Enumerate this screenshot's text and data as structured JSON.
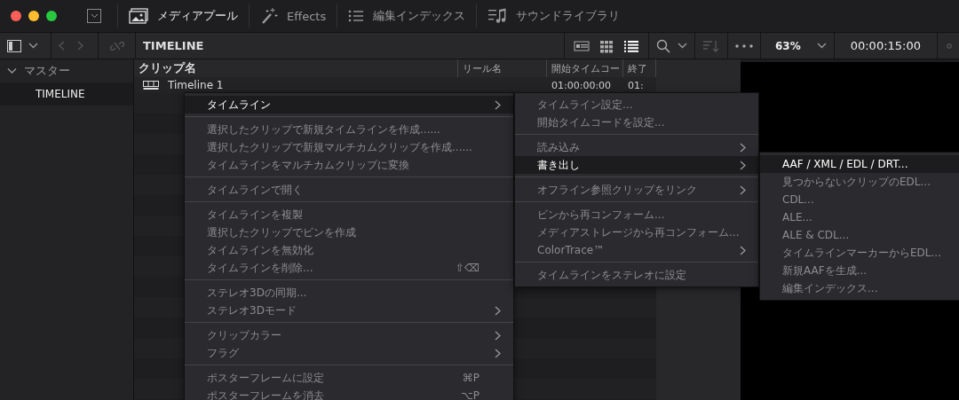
{
  "toolbar": {
    "tabs": [
      {
        "label": "メディアプール",
        "selected": true
      },
      {
        "label": "Effects",
        "selected": false
      },
      {
        "label": "編集インデックス",
        "selected": false
      },
      {
        "label": "サウンドライブラリ",
        "selected": false
      }
    ]
  },
  "bin_bar": {
    "title": "TIMELINE",
    "views": [
      {
        "selected": false
      },
      {
        "selected": false
      },
      {
        "selected": true
      }
    ],
    "zoom": "63%",
    "timecode": "00:00:15:00"
  },
  "sidebar": {
    "items": [
      {
        "label": "マスター",
        "expanded": true,
        "selected": false,
        "children": [
          {
            "label": "TIMELINE",
            "selected": true
          }
        ]
      }
    ]
  },
  "table": {
    "columns": [
      "クリップ名",
      "リール名",
      "開始タイムコー",
      "終了"
    ],
    "rows": [
      {
        "cells": [
          "Timeline 1",
          "",
          "01:00:00:00",
          "01:"
        ]
      }
    ]
  },
  "menus": [
    {
      "items": [
        {
          "kind": "item",
          "label": "タイムライン",
          "selected": true,
          "disabled": false,
          "submenu": true
        },
        {
          "kind": "separator"
        },
        {
          "kind": "item",
          "label": "選択したクリップで新規タイムラインを作成......",
          "selected": false,
          "disabled": true,
          "submenu": false
        },
        {
          "kind": "item",
          "label": "選択したクリップで新規マルチカムクリップを作成......",
          "selected": false,
          "disabled": true,
          "submenu": false
        },
        {
          "kind": "item",
          "label": "タイムラインをマルチカムクリップに変換",
          "selected": false,
          "disabled": true,
          "submenu": false
        },
        {
          "kind": "separator"
        },
        {
          "kind": "item",
          "label": "タイムラインで開く",
          "selected": false,
          "disabled": true,
          "submenu": false
        },
        {
          "kind": "separator"
        },
        {
          "kind": "item",
          "label": "タイムラインを複製",
          "selected": false,
          "disabled": true,
          "submenu": false
        },
        {
          "kind": "item",
          "label": "選択したクリップでビンを作成",
          "selected": false,
          "disabled": true,
          "submenu": false
        },
        {
          "kind": "item",
          "label": "タイムラインを無効化",
          "selected": false,
          "disabled": true,
          "submenu": false
        },
        {
          "kind": "item",
          "label": "タイムラインを削除...",
          "shortcut": "⇧⌫",
          "selected": false,
          "disabled": true,
          "submenu": false
        },
        {
          "kind": "separator"
        },
        {
          "kind": "item",
          "label": "ステレオ3Dの同期...",
          "selected": false,
          "disabled": true,
          "submenu": false
        },
        {
          "kind": "item",
          "label": "ステレオ3Dモード",
          "selected": false,
          "disabled": true,
          "submenu": true
        },
        {
          "kind": "separator"
        },
        {
          "kind": "item",
          "label": "クリップカラー",
          "selected": false,
          "disabled": true,
          "submenu": true
        },
        {
          "kind": "item",
          "label": "フラグ",
          "selected": false,
          "disabled": true,
          "submenu": true
        },
        {
          "kind": "separator"
        },
        {
          "kind": "item",
          "label": "ポスターフレームに設定",
          "shortcut": "⌘P",
          "selected": false,
          "disabled": true,
          "submenu": false
        },
        {
          "kind": "item",
          "label": "ポスターフレームを消去",
          "shortcut": "⌥P",
          "selected": false,
          "disabled": true,
          "submenu": false
        }
      ]
    },
    {
      "items": [
        {
          "kind": "item",
          "label": "タイムライン設定...",
          "selected": false,
          "disabled": true,
          "submenu": false
        },
        {
          "kind": "item",
          "label": "開始タイムコードを設定...",
          "selected": false,
          "disabled": true,
          "submenu": false
        },
        {
          "kind": "separator"
        },
        {
          "kind": "item",
          "label": "読み込み",
          "selected": false,
          "disabled": true,
          "submenu": true
        },
        {
          "kind": "item",
          "label": "書き出し",
          "selected": true,
          "disabled": false,
          "submenu": true
        },
        {
          "kind": "separator"
        },
        {
          "kind": "item",
          "label": "オフライン参照クリップをリンク",
          "selected": false,
          "disabled": true,
          "submenu": true
        },
        {
          "kind": "separator"
        },
        {
          "kind": "item",
          "label": "ビンから再コンフォーム...",
          "selected": false,
          "disabled": true,
          "submenu": false
        },
        {
          "kind": "item",
          "label": "メディアストレージから再コンフォーム...",
          "selected": false,
          "disabled": true,
          "submenu": false
        },
        {
          "kind": "item",
          "label": "ColorTrace™",
          "selected": false,
          "disabled": true,
          "submenu": true
        },
        {
          "kind": "separator"
        },
        {
          "kind": "item",
          "label": "タイムラインをステレオに設定",
          "selected": false,
          "disabled": true,
          "submenu": false
        }
      ]
    },
    {
      "items": [
        {
          "kind": "item",
          "label": "AAF / XML / EDL / DRT...",
          "selected": true,
          "disabled": false,
          "submenu": false
        },
        {
          "kind": "item",
          "label": "見つからないクリップのEDL...",
          "selected": false,
          "disabled": true,
          "submenu": false
        },
        {
          "kind": "item",
          "label": "CDL...",
          "selected": false,
          "disabled": true,
          "submenu": false
        },
        {
          "kind": "item",
          "label": "ALE...",
          "selected": false,
          "disabled": true,
          "submenu": false
        },
        {
          "kind": "item",
          "label": "ALE & CDL...",
          "selected": false,
          "disabled": true,
          "submenu": false
        },
        {
          "kind": "item",
          "label": "タイムラインマーカーからEDL...",
          "selected": false,
          "disabled": true,
          "submenu": false
        },
        {
          "kind": "item",
          "label": "新規AAFを生成...",
          "selected": false,
          "disabled": true,
          "submenu": false
        },
        {
          "kind": "item",
          "label": "編集インデックス...",
          "selected": false,
          "disabled": true,
          "submenu": false
        }
      ]
    }
  ]
}
